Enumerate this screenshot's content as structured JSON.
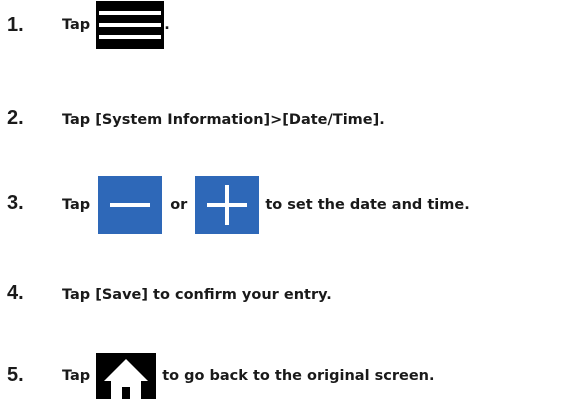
{
  "steps": [
    {
      "number": "1.",
      "tap": "Tap",
      "after": "."
    },
    {
      "number": "2.",
      "text": "Tap [System Information]>[Date/Time]."
    },
    {
      "number": "3.",
      "tap": "Tap",
      "or": "or",
      "after": "to set the date and time."
    },
    {
      "number": "4.",
      "text": "Tap [Save] to confirm your entry."
    },
    {
      "number": "5.",
      "tap": "Tap",
      "after": "to go back to the original screen."
    }
  ],
  "icons": {
    "menu": "menu-icon",
    "minus": "minus-icon",
    "plus": "plus-icon",
    "home": "home-icon"
  },
  "colors": {
    "text": "#1a1a1a",
    "icon_dark": "#000000",
    "icon_blue": "#2e68b8",
    "glyph": "#ffffff"
  }
}
